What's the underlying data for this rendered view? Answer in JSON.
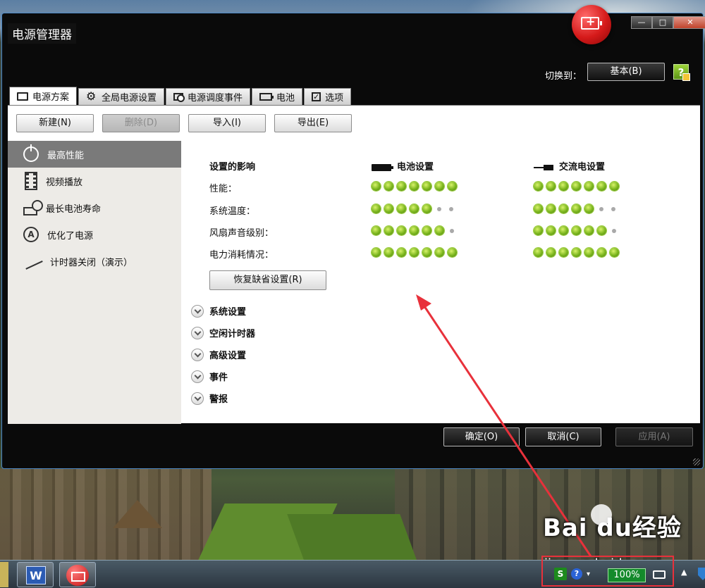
{
  "window": {
    "title": "电源管理器",
    "controls": {
      "minimize": "—",
      "maximize": "□",
      "close": "✕"
    }
  },
  "header": {
    "switch_label": "切换到：",
    "switch_button": "基本(B)",
    "help_glyph": "?"
  },
  "tabs": [
    {
      "label": "电源方案",
      "icon": "document-icon",
      "active": true
    },
    {
      "label": "全局电源设置",
      "icon": "gear-icon"
    },
    {
      "label": "电源调度事件",
      "icon": "schedule-icon"
    },
    {
      "label": "电池",
      "icon": "battery-icon"
    },
    {
      "label": "选项",
      "icon": "checkbox-icon"
    }
  ],
  "toolbar": {
    "new": "新建(N)",
    "delete": "删除(D)",
    "import": "导入(I)",
    "export": "导出(E)"
  },
  "sidebar": {
    "items": [
      {
        "label": "最高性能",
        "icon": "power-icon",
        "active": true
      },
      {
        "label": "视频播放",
        "icon": "film-icon"
      },
      {
        "label": "最长电池寿命",
        "icon": "battery-clock-icon"
      },
      {
        "label": "优化了电源",
        "icon": "auto-icon"
      },
      {
        "label": "计时器关闭（演示）",
        "icon": "plug-icon"
      }
    ]
  },
  "effects": {
    "heading": "设置的影响",
    "battery_heading": "电池设置",
    "ac_heading": "交流电设置",
    "rows": [
      {
        "label": "性能：",
        "battery_level": 7,
        "ac_level": 7,
        "max": 7
      },
      {
        "label": "系统温度：",
        "battery_level": 5,
        "ac_level": 5,
        "max": 7
      },
      {
        "label": "风扇声音级别：",
        "battery_level": 6,
        "ac_level": 6,
        "max": 7
      },
      {
        "label": "电力消耗情况：",
        "battery_level": 7,
        "ac_level": 7,
        "max": 7
      }
    ],
    "restore_button": "恢复缺省设置(R)"
  },
  "sections": [
    {
      "label": "系统设置"
    },
    {
      "label": "空闲计时器"
    },
    {
      "label": "高级设置"
    },
    {
      "label": "事件"
    },
    {
      "label": "警报"
    }
  ],
  "footer": {
    "ok": "确定(O)",
    "cancel": "取消(C)",
    "apply": "应用(A)"
  },
  "taskbar": {
    "word_glyph": "W",
    "tray_s": "S",
    "tray_q": "?",
    "battery_percent": "100%"
  },
  "watermark": {
    "logo": "Bai du经验",
    "url": "jingyan.baidu.com"
  },
  "colors": {
    "accent_green": "#7ab51d",
    "annotation_red": "#e8313b",
    "window_border": "#4d88c4"
  }
}
